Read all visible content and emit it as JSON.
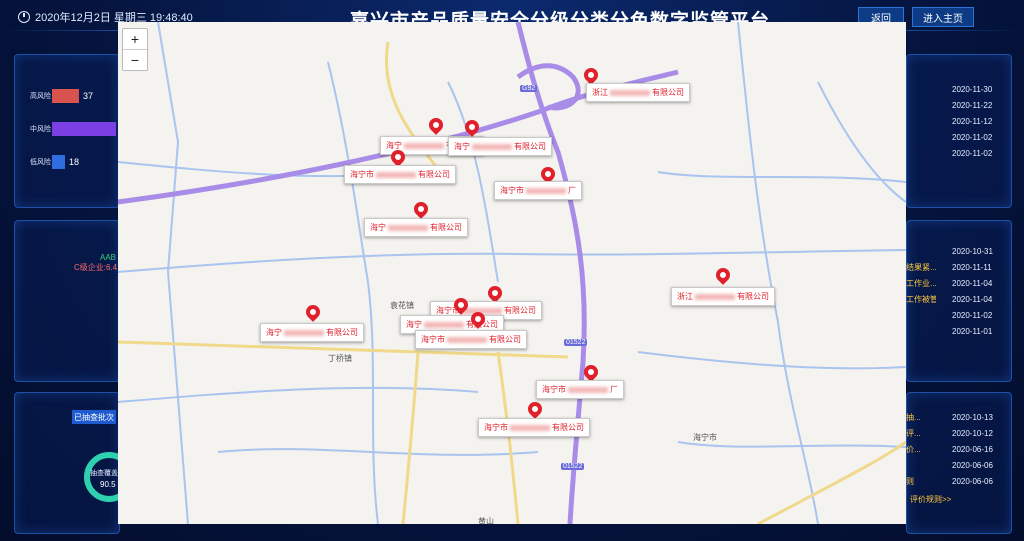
{
  "header": {
    "datetime": "2020年12月2日 星期三 19:48:40",
    "title": "嘉兴市产品质量安全分级分类分色数字监管平台",
    "back_label": "返回",
    "home_label": "进入主页"
  },
  "risk_levels": [
    {
      "label": "高风险",
      "value": "37",
      "color": "#d9534f",
      "fraction": 0.42
    },
    {
      "label": "中风险",
      "value": "",
      "color": "#7b3fe4",
      "fraction": 1.0
    },
    {
      "label": "低风险",
      "value": "18",
      "color": "#2f6ee0",
      "fraction": 0.21
    }
  ],
  "left_panels": {
    "aab": "AAB",
    "class_c": "C级企业:6.4",
    "batch_tag": "已抽查批次",
    "gauge_label": "抽查覆盖",
    "gauge_value": "90.5"
  },
  "right_lists": {
    "list1": [
      "2020-11-30",
      "2020-11-22",
      "2020-11-12",
      "2020-11-02",
      "2020-11-02"
    ],
    "list2": [
      "2020-10-31",
      "2020-11-11",
      "2020-11-04",
      "2020-11-04",
      "2020-11-02",
      "2020-11-01"
    ],
    "list2_peek": [
      "",
      "结果紧...",
      "工作业...",
      "工作被管..."
    ],
    "list3": [
      "2020-10-13",
      "2020-10-12",
      "2020-06-16",
      "2020-06-06",
      "2020-06-06"
    ],
    "list3_peek": [
      "抽...",
      "评...",
      "价...",
      "",
      "则"
    ],
    "rule_link": "评价规则>>"
  },
  "map": {
    "zoom_in": "+",
    "zoom_out": "−",
    "places": [
      {
        "name": "丁桥镇"
      },
      {
        "name": "袁花镇"
      },
      {
        "name": "海宁市"
      },
      {
        "name": "黄山"
      }
    ],
    "road_numbers": [
      "G92",
      "01522",
      "01522"
    ],
    "markers": [
      {
        "prefix": "浙江",
        "suffix": "有限公司"
      },
      {
        "prefix": "海宁",
        "suffix": "有限公司"
      },
      {
        "prefix": "海宁",
        "suffix": "有限公司"
      },
      {
        "prefix": "海宁市",
        "suffix": "有限公司"
      },
      {
        "prefix": "海宁",
        "suffix": "有限公司"
      },
      {
        "prefix": "海宁市",
        "suffix": "厂"
      },
      {
        "prefix": "浙江",
        "suffix": "有限公司"
      },
      {
        "prefix": "海宁",
        "suffix": "有限公司"
      },
      {
        "prefix": "海宁市",
        "suffix": "有限公司"
      },
      {
        "prefix": "海宁",
        "suffix": "有限公司"
      },
      {
        "prefix": "海宁市",
        "suffix": "有限公司"
      },
      {
        "prefix": "海宁市",
        "suffix": "厂"
      },
      {
        "prefix": "海宁市",
        "suffix": "有限公司"
      }
    ]
  }
}
